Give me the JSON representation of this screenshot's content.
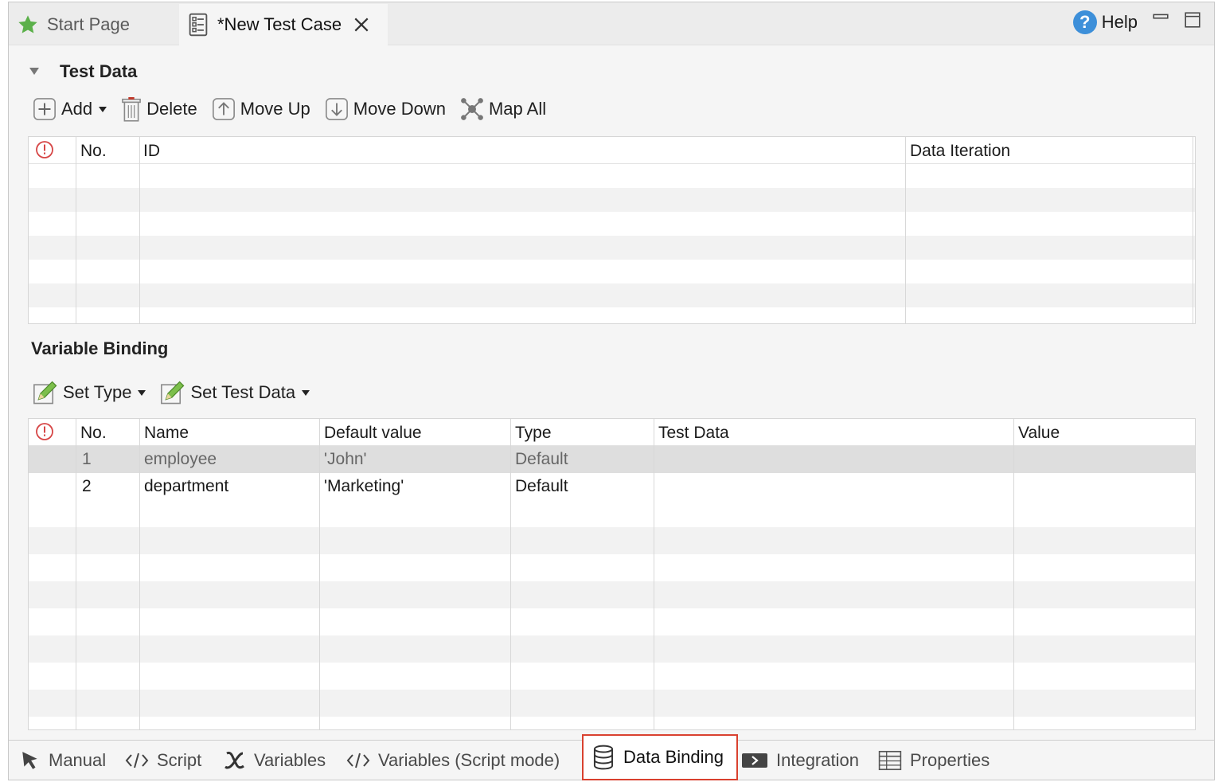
{
  "tabs": {
    "start_page": "Start Page",
    "new_test_case": "*New Test Case",
    "help": "Help"
  },
  "test_data": {
    "title": "Test Data",
    "toolbar": {
      "add": "Add",
      "delete": "Delete",
      "move_up": "Move Up",
      "move_down": "Move Down",
      "map_all": "Map All"
    },
    "columns": {
      "no": "No.",
      "id": "ID",
      "data_iteration": "Data Iteration"
    }
  },
  "variable_binding": {
    "title": "Variable Binding",
    "toolbar": {
      "set_type": "Set Type",
      "set_test_data": "Set Test Data"
    },
    "columns": {
      "no": "No.",
      "name": "Name",
      "default_value": "Default value",
      "type": "Type",
      "test_data": "Test Data",
      "value": "Value"
    },
    "rows": [
      {
        "no": "1",
        "name": "employee",
        "default_value": "'John'",
        "type": "Default",
        "test_data": "",
        "value": ""
      },
      {
        "no": "2",
        "name": "department",
        "default_value": "'Marketing'",
        "type": "Default",
        "test_data": "",
        "value": ""
      }
    ]
  },
  "bottom_tabs": {
    "manual": "Manual",
    "script": "Script",
    "variables": "Variables",
    "variables_script": "Variables (Script mode)",
    "data_binding": "Data Binding",
    "integration": "Integration",
    "properties": "Properties"
  },
  "colors": {
    "active_tab_border": "#d9412f",
    "help_icon": "#3d8fd9",
    "error_icon": "#d64545",
    "star_icon": "#5bb04a"
  }
}
